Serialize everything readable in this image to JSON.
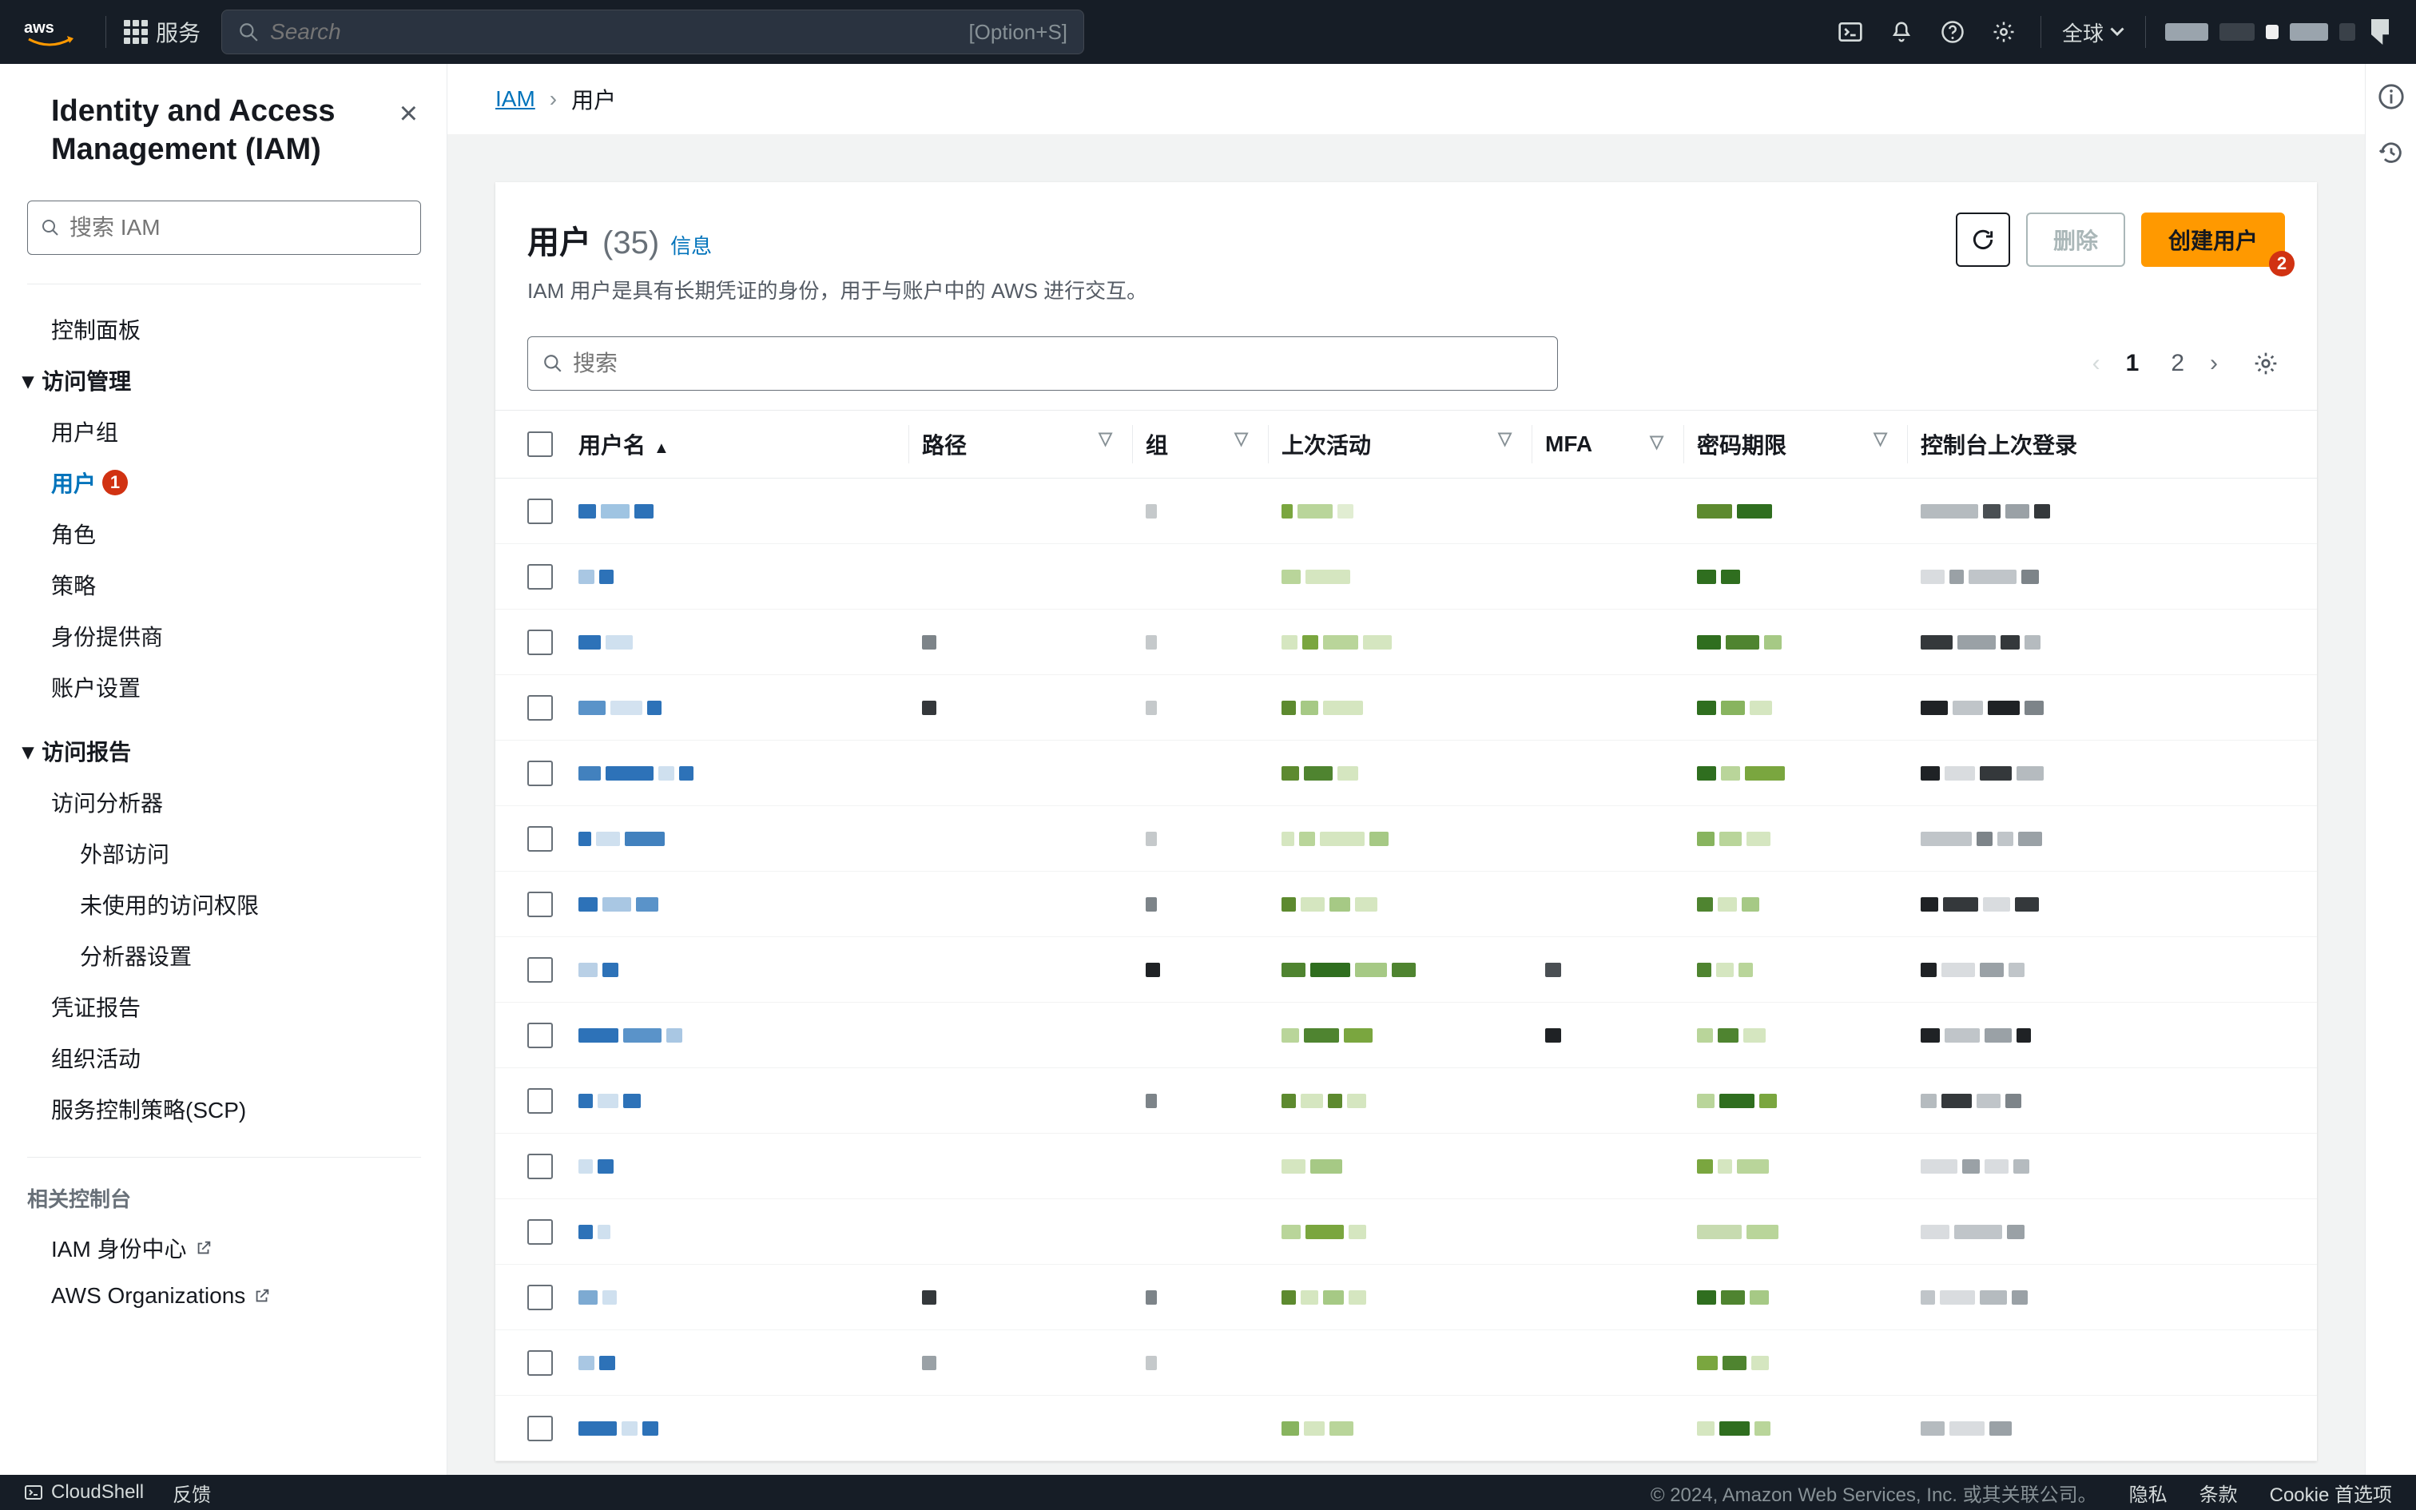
{
  "navbar": {
    "services_label": "服务",
    "search_placeholder": "Search",
    "search_shortcut": "[Option+S]",
    "region": "全球"
  },
  "sidebar": {
    "title": "Identity and Access Management (IAM)",
    "search_placeholder": "搜索 IAM",
    "dashboard": "控制面板",
    "access_mgmt_label": "访问管理",
    "access_mgmt_items": {
      "user_groups": "用户组",
      "users": "用户",
      "users_badge": "1",
      "roles": "角色",
      "policies": "策略",
      "identity_providers": "身份提供商",
      "account_settings": "账户设置"
    },
    "access_reports_label": "访问报告",
    "access_reports_items": {
      "analyzer": "访问分析器",
      "external_access": "外部访问",
      "unused_access": "未使用的访问权限",
      "analyzer_settings": "分析器设置",
      "credential_report": "凭证报告",
      "org_activity": "组织活动",
      "scp": "服务控制策略(SCP)"
    },
    "related_label": "相关控制台",
    "related_items": {
      "identity_center": "IAM 身份中心",
      "organizations": "AWS Organizations"
    }
  },
  "breadcrumb": {
    "root": "IAM",
    "current": "用户"
  },
  "panel": {
    "title": "用户",
    "count": "(35)",
    "info_link": "信息",
    "description": "IAM 用户是具有长期凭证的身份，用于与账户中的 AWS 进行交互。",
    "delete_btn": "删除",
    "create_btn": "创建用户",
    "create_badge": "2",
    "search_placeholder": "搜索",
    "pages": [
      "1",
      "2"
    ],
    "active_page": "1"
  },
  "table": {
    "columns": {
      "username": "用户名",
      "path": "路径",
      "groups": "组",
      "last_activity": "上次活动",
      "mfa": "MFA",
      "password_age": "密码期限",
      "console_last_login": "控制台上次登录"
    },
    "rows": [
      {
        "u": [
          {
            "w": 22,
            "c": "#2d72b8"
          },
          {
            "w": 36,
            "c": "#9fc4e2"
          },
          {
            "w": 24,
            "c": "#2d72b8"
          }
        ],
        "p": [],
        "g": [
          {
            "w": 14,
            "c": "#c5c9cb"
          }
        ],
        "a": [
          {
            "w": 14,
            "c": "#7aa63f"
          },
          {
            "w": 44,
            "c": "#b9d59a"
          },
          {
            "w": 20,
            "c": "#e1edd2"
          }
        ],
        "m": [],
        "pw": [
          {
            "w": 44,
            "c": "#5d8a2f"
          },
          {
            "w": 44,
            "c": "#2f6e1f"
          }
        ],
        "c": [
          {
            "w": 72,
            "c": "#b5bbbf"
          },
          {
            "w": 22,
            "c": "#4a4f53"
          },
          {
            "w": 30,
            "c": "#9aa1a6"
          },
          {
            "w": 20,
            "c": "#34383b"
          }
        ]
      },
      {
        "u": [
          {
            "w": 20,
            "c": "#a9c7e3"
          },
          {
            "w": 18,
            "c": "#2d72b8"
          }
        ],
        "p": [],
        "g": [],
        "a": [
          {
            "w": 24,
            "c": "#b9d59a"
          },
          {
            "w": 56,
            "c": "#d5e6c0"
          }
        ],
        "m": [],
        "pw": [
          {
            "w": 24,
            "c": "#2f6e1f"
          },
          {
            "w": 24,
            "c": "#2f6e1f"
          }
        ],
        "c": [
          {
            "w": 30,
            "c": "#d9dcdf"
          },
          {
            "w": 18,
            "c": "#9aa1a6"
          },
          {
            "w": 60,
            "c": "#c0c5c9"
          },
          {
            "w": 22,
            "c": "#7d8489"
          }
        ]
      },
      {
        "u": [
          {
            "w": 28,
            "c": "#2d72b8"
          },
          {
            "w": 34,
            "c": "#cfe0ef"
          }
        ],
        "p": [
          {
            "w": 18,
            "c": "#7d8489"
          }
        ],
        "g": [
          {
            "w": 14,
            "c": "#c5c9cb"
          }
        ],
        "a": [
          {
            "w": 20,
            "c": "#d5e6c0"
          },
          {
            "w": 20,
            "c": "#7aa63f"
          },
          {
            "w": 44,
            "c": "#b9d59a"
          },
          {
            "w": 36,
            "c": "#d5e6c0"
          }
        ],
        "m": [],
        "pw": [
          {
            "w": 30,
            "c": "#2f6e1f"
          },
          {
            "w": 42,
            "c": "#4f8430"
          },
          {
            "w": 22,
            "c": "#a6c985"
          }
        ],
        "c": [
          {
            "w": 40,
            "c": "#34383b"
          },
          {
            "w": 48,
            "c": "#9aa1a6"
          },
          {
            "w": 24,
            "c": "#34383b"
          },
          {
            "w": 20,
            "c": "#b5bbbf"
          }
        ]
      },
      {
        "u": [
          {
            "w": 34,
            "c": "#5a93c9"
          },
          {
            "w": 40,
            "c": "#d3e2f0"
          },
          {
            "w": 18,
            "c": "#2d72b8"
          }
        ],
        "p": [
          {
            "w": 18,
            "c": "#34383b"
          }
        ],
        "g": [
          {
            "w": 14,
            "c": "#c5c9cb"
          }
        ],
        "a": [
          {
            "w": 18,
            "c": "#5d8a2f"
          },
          {
            "w": 22,
            "c": "#a6c985"
          },
          {
            "w": 50,
            "c": "#d5e6c0"
          }
        ],
        "m": [],
        "pw": [
          {
            "w": 24,
            "c": "#2f6e1f"
          },
          {
            "w": 30,
            "c": "#88b45f"
          },
          {
            "w": 28,
            "c": "#d5e6c0"
          }
        ],
        "c": [
          {
            "w": 34,
            "c": "#1f2225"
          },
          {
            "w": 38,
            "c": "#c0c5c9"
          },
          {
            "w": 40,
            "c": "#1f2225"
          },
          {
            "w": 24,
            "c": "#7d8489"
          }
        ]
      },
      {
        "u": [
          {
            "w": 28,
            "c": "#4281be"
          },
          {
            "w": 60,
            "c": "#2d72b8"
          },
          {
            "w": 20,
            "c": "#cfe0ef"
          },
          {
            "w": 18,
            "c": "#2d72b8"
          }
        ],
        "p": [],
        "g": [],
        "a": [
          {
            "w": 22,
            "c": "#5d8a2f"
          },
          {
            "w": 36,
            "c": "#4f8430"
          },
          {
            "w": 26,
            "c": "#d5e6c0"
          }
        ],
        "m": [],
        "pw": [
          {
            "w": 24,
            "c": "#2f6e1f"
          },
          {
            "w": 24,
            "c": "#b9d59a"
          },
          {
            "w": 50,
            "c": "#7aa63f"
          }
        ],
        "c": [
          {
            "w": 24,
            "c": "#1f2225"
          },
          {
            "w": 38,
            "c": "#d9dcdf"
          },
          {
            "w": 40,
            "c": "#34383b"
          },
          {
            "w": 34,
            "c": "#b5bbbf"
          }
        ]
      },
      {
        "u": [
          {
            "w": 16,
            "c": "#2d72b8"
          },
          {
            "w": 30,
            "c": "#cfe0ef"
          },
          {
            "w": 50,
            "c": "#4281be"
          }
        ],
        "p": [],
        "g": [
          {
            "w": 14,
            "c": "#c5c9cb"
          }
        ],
        "a": [
          {
            "w": 16,
            "c": "#d5e6c0"
          },
          {
            "w": 20,
            "c": "#b9d59a"
          },
          {
            "w": 56,
            "c": "#d5e6c0"
          },
          {
            "w": 24,
            "c": "#a6c985"
          }
        ],
        "m": [],
        "pw": [
          {
            "w": 22,
            "c": "#88b45f"
          },
          {
            "w": 28,
            "c": "#b9d59a"
          },
          {
            "w": 30,
            "c": "#d5e6c0"
          }
        ],
        "c": [
          {
            "w": 64,
            "c": "#c0c5c9"
          },
          {
            "w": 20,
            "c": "#7d8489"
          },
          {
            "w": 20,
            "c": "#c0c5c9"
          },
          {
            "w": 30,
            "c": "#9aa1a6"
          }
        ]
      },
      {
        "u": [
          {
            "w": 24,
            "c": "#2d72b8"
          },
          {
            "w": 36,
            "c": "#a9c7e3"
          },
          {
            "w": 28,
            "c": "#5a93c9"
          }
        ],
        "p": [],
        "g": [
          {
            "w": 14,
            "c": "#7d8489"
          }
        ],
        "a": [
          {
            "w": 18,
            "c": "#5d8a2f"
          },
          {
            "w": 30,
            "c": "#d5e6c0"
          },
          {
            "w": 26,
            "c": "#a6c985"
          },
          {
            "w": 28,
            "c": "#d5e6c0"
          }
        ],
        "m": [],
        "pw": [
          {
            "w": 20,
            "c": "#4f8430"
          },
          {
            "w": 24,
            "c": "#d5e6c0"
          },
          {
            "w": 22,
            "c": "#a6c985"
          }
        ],
        "c": [
          {
            "w": 22,
            "c": "#1f2225"
          },
          {
            "w": 44,
            "c": "#34383b"
          },
          {
            "w": 34,
            "c": "#d9dcdf"
          },
          {
            "w": 30,
            "c": "#34383b"
          }
        ]
      },
      {
        "u": [
          {
            "w": 24,
            "c": "#b9d0e6"
          },
          {
            "w": 20,
            "c": "#2d72b8"
          }
        ],
        "p": [],
        "g": [
          {
            "w": 18,
            "c": "#1f2225"
          }
        ],
        "a": [
          {
            "w": 30,
            "c": "#4f8430"
          },
          {
            "w": 50,
            "c": "#2f6e1f"
          },
          {
            "w": 40,
            "c": "#a6c985"
          },
          {
            "w": 30,
            "c": "#4f8430"
          }
        ],
        "m": [
          {
            "w": 20,
            "c": "#4a4f53"
          }
        ],
        "pw": [
          {
            "w": 18,
            "c": "#4f8430"
          },
          {
            "w": 22,
            "c": "#d5e6c0"
          },
          {
            "w": 18,
            "c": "#b9d59a"
          }
        ],
        "c": [
          {
            "w": 20,
            "c": "#1f2225"
          },
          {
            "w": 42,
            "c": "#d9dcdf"
          },
          {
            "w": 30,
            "c": "#9aa1a6"
          },
          {
            "w": 20,
            "c": "#c0c5c9"
          }
        ]
      },
      {
        "u": [
          {
            "w": 50,
            "c": "#2d72b8"
          },
          {
            "w": 48,
            "c": "#5a93c9"
          },
          {
            "w": 20,
            "c": "#a9c7e3"
          }
        ],
        "p": [],
        "g": [],
        "a": [
          {
            "w": 22,
            "c": "#b9d59a"
          },
          {
            "w": 44,
            "c": "#4f8430"
          },
          {
            "w": 36,
            "c": "#7aa63f"
          }
        ],
        "m": [
          {
            "w": 20,
            "c": "#1f2225"
          }
        ],
        "pw": [
          {
            "w": 20,
            "c": "#b9d59a"
          },
          {
            "w": 26,
            "c": "#4f8430"
          },
          {
            "w": 28,
            "c": "#d5e6c0"
          }
        ],
        "c": [
          {
            "w": 24,
            "c": "#1f2225"
          },
          {
            "w": 44,
            "c": "#c0c5c9"
          },
          {
            "w": 34,
            "c": "#9aa1a6"
          },
          {
            "w": 18,
            "c": "#1f2225"
          }
        ]
      },
      {
        "u": [
          {
            "w": 18,
            "c": "#2d72b8"
          },
          {
            "w": 26,
            "c": "#cfe0ef"
          },
          {
            "w": 22,
            "c": "#2d72b8"
          }
        ],
        "p": [],
        "g": [
          {
            "w": 14,
            "c": "#7d8489"
          }
        ],
        "a": [
          {
            "w": 18,
            "c": "#5d8a2f"
          },
          {
            "w": 28,
            "c": "#d5e6c0"
          },
          {
            "w": 18,
            "c": "#5d8a2f"
          },
          {
            "w": 24,
            "c": "#d5e6c0"
          }
        ],
        "m": [],
        "pw": [
          {
            "w": 22,
            "c": "#b9d59a"
          },
          {
            "w": 44,
            "c": "#2f6e1f"
          },
          {
            "w": 22,
            "c": "#7aa63f"
          }
        ],
        "c": [
          {
            "w": 20,
            "c": "#b5bbbf"
          },
          {
            "w": 38,
            "c": "#34383b"
          },
          {
            "w": 30,
            "c": "#c0c5c9"
          },
          {
            "w": 20,
            "c": "#7d8489"
          }
        ]
      },
      {
        "u": [
          {
            "w": 18,
            "c": "#cfe0ef"
          },
          {
            "w": 20,
            "c": "#2d72b8"
          }
        ],
        "p": [],
        "g": [],
        "a": [
          {
            "w": 30,
            "c": "#d5e6c0"
          },
          {
            "w": 40,
            "c": "#a6c985"
          }
        ],
        "m": [],
        "pw": [
          {
            "w": 20,
            "c": "#7aa63f"
          },
          {
            "w": 18,
            "c": "#d5e6c0"
          },
          {
            "w": 40,
            "c": "#b9d59a"
          }
        ],
        "c": [
          {
            "w": 46,
            "c": "#d9dcdf"
          },
          {
            "w": 22,
            "c": "#9aa1a6"
          },
          {
            "w": 30,
            "c": "#d9dcdf"
          },
          {
            "w": 20,
            "c": "#b5bbbf"
          }
        ]
      },
      {
        "u": [
          {
            "w": 18,
            "c": "#2d72b8"
          },
          {
            "w": 16,
            "c": "#cfe0ef"
          }
        ],
        "p": [],
        "g": [],
        "a": [
          {
            "w": 24,
            "c": "#b9d59a"
          },
          {
            "w": 48,
            "c": "#7aa63f"
          },
          {
            "w": 22,
            "c": "#d5e6c0"
          }
        ],
        "m": [],
        "pw": [
          {
            "w": 56,
            "c": "#c7dbb0"
          },
          {
            "w": 40,
            "c": "#b9d59a"
          }
        ],
        "c": [
          {
            "w": 36,
            "c": "#d9dcdf"
          },
          {
            "w": 60,
            "c": "#c0c5c9"
          },
          {
            "w": 22,
            "c": "#9aa1a6"
          }
        ]
      },
      {
        "u": [
          {
            "w": 24,
            "c": "#7daad2"
          },
          {
            "w": 18,
            "c": "#cfe0ef"
          }
        ],
        "p": [
          {
            "w": 18,
            "c": "#34383b"
          }
        ],
        "g": [
          {
            "w": 14,
            "c": "#7d8489"
          }
        ],
        "a": [
          {
            "w": 18,
            "c": "#5d8a2f"
          },
          {
            "w": 22,
            "c": "#d5e6c0"
          },
          {
            "w": 26,
            "c": "#a6c985"
          },
          {
            "w": 22,
            "c": "#d5e6c0"
          }
        ],
        "m": [],
        "pw": [
          {
            "w": 24,
            "c": "#2f6e1f"
          },
          {
            "w": 30,
            "c": "#4f8430"
          },
          {
            "w": 24,
            "c": "#a6c985"
          }
        ],
        "c": [
          {
            "w": 18,
            "c": "#c0c5c9"
          },
          {
            "w": 44,
            "c": "#d9dcdf"
          },
          {
            "w": 34,
            "c": "#b5bbbf"
          },
          {
            "w": 20,
            "c": "#9aa1a6"
          }
        ]
      },
      {
        "u": [
          {
            "w": 20,
            "c": "#a9c7e3"
          },
          {
            "w": 20,
            "c": "#2d72b8"
          }
        ],
        "p": [
          {
            "w": 18,
            "c": "#9aa1a6"
          }
        ],
        "g": [
          {
            "w": 14,
            "c": "#c5c9cb"
          }
        ],
        "a": [],
        "m": [],
        "pw": [
          {
            "w": 26,
            "c": "#7aa63f"
          },
          {
            "w": 30,
            "c": "#4f8430"
          },
          {
            "w": 22,
            "c": "#d5e6c0"
          }
        ],
        "c": []
      },
      {
        "u": [
          {
            "w": 48,
            "c": "#2d72b8"
          },
          {
            "w": 20,
            "c": "#cfe0ef"
          },
          {
            "w": 20,
            "c": "#2d72b8"
          }
        ],
        "p": [],
        "g": [],
        "a": [
          {
            "w": 22,
            "c": "#88b45f"
          },
          {
            "w": 26,
            "c": "#d5e6c0"
          },
          {
            "w": 30,
            "c": "#b9d59a"
          }
        ],
        "m": [],
        "pw": [
          {
            "w": 22,
            "c": "#d5e6c0"
          },
          {
            "w": 38,
            "c": "#2f6e1f"
          },
          {
            "w": 20,
            "c": "#b9d59a"
          }
        ],
        "c": [
          {
            "w": 30,
            "c": "#b5bbbf"
          },
          {
            "w": 44,
            "c": "#d9dcdf"
          },
          {
            "w": 28,
            "c": "#9aa1a6"
          }
        ]
      }
    ]
  },
  "footer": {
    "cloudshell": "CloudShell",
    "feedback": "反馈",
    "copyright": "© 2024, Amazon Web Services, Inc. 或其关联公司。",
    "privacy": "隐私",
    "terms": "条款",
    "cookie": "Cookie 首选项"
  }
}
